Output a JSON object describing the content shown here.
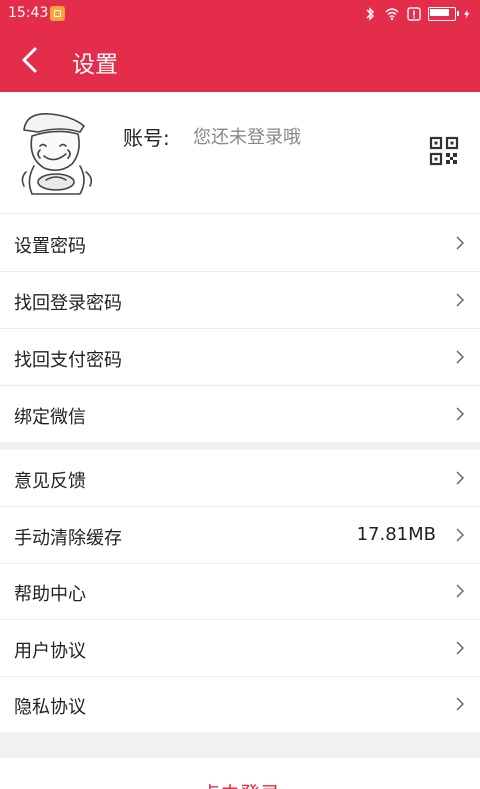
{
  "status_bar": {
    "time": "15:43"
  },
  "header": {
    "title": "设置"
  },
  "account": {
    "label": "账号:",
    "value": "您还未登录哦"
  },
  "menu_group_1": [
    {
      "label": "设置密码"
    },
    {
      "label": "找回登录密码"
    },
    {
      "label": "找回支付密码"
    },
    {
      "label": "绑定微信"
    }
  ],
  "menu_group_2": [
    {
      "label": "意见反馈"
    },
    {
      "label": "手动清除缓存",
      "value": "17.81MB"
    },
    {
      "label": "帮助中心"
    },
    {
      "label": "用户协议"
    },
    {
      "label": "隐私协议"
    }
  ],
  "login_button": {
    "label": "点击登录"
  },
  "colors": {
    "primary": "#e42d4b",
    "divider": "#ececec",
    "section_bg": "#f1f1f1"
  },
  "icons": [
    "notification-icon",
    "bluetooth-icon",
    "wifi-icon",
    "alert-icon",
    "battery-icon",
    "charging-icon",
    "back-arrow-icon",
    "avatar",
    "qr-code-icon",
    "chevron-right-icon"
  ]
}
